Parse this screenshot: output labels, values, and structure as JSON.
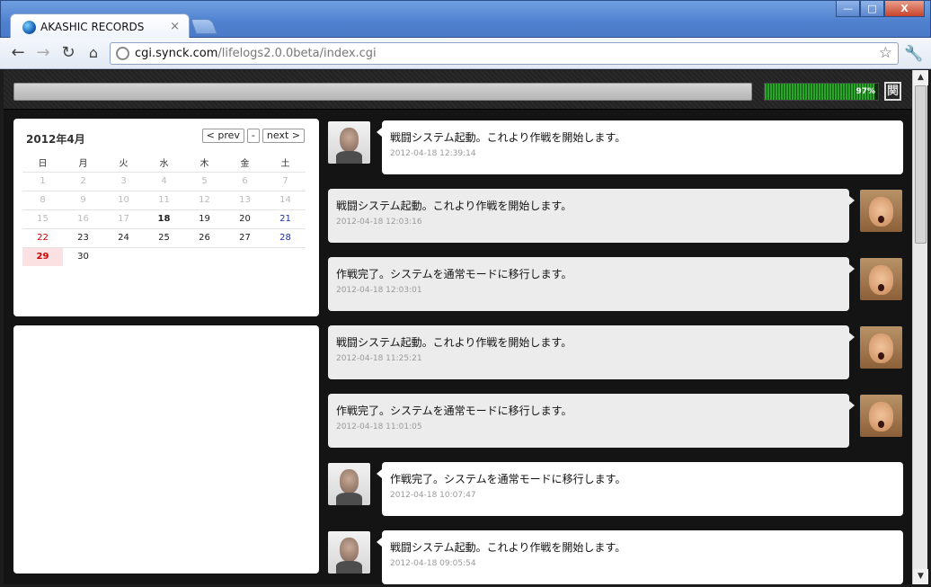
{
  "browser": {
    "tab_title": "AKASHIC RECORDS",
    "tab_close": "×",
    "url_host": "cgi.synck.com",
    "url_path": "/lifelogs2.0.0beta/index.cgi",
    "icons": [
      "globe-icon",
      "back-icon",
      "forward-icon",
      "reload-icon",
      "home-icon",
      "star-icon",
      "wrench-icon"
    ]
  },
  "header": {
    "meter_percent": 97,
    "meter_label": "97%",
    "logo_glyph": "関"
  },
  "calendar": {
    "title": "2012年4月",
    "prev_label": "< prev",
    "current_label": "-",
    "next_label": "next >",
    "weekdays": [
      "日",
      "月",
      "火",
      "水",
      "木",
      "金",
      "土"
    ],
    "weeks": [
      [
        "1",
        "2",
        "3",
        "4",
        "5",
        "6",
        "7"
      ],
      [
        "8",
        "9",
        "10",
        "11",
        "12",
        "13",
        "14"
      ],
      [
        "15",
        "16",
        "17",
        "18",
        "19",
        "20",
        "21"
      ],
      [
        "22",
        "23",
        "24",
        "25",
        "26",
        "27",
        "28"
      ],
      [
        "29",
        "30",
        "",
        "",
        "",
        "",
        ""
      ]
    ],
    "today": "29",
    "bold_day": "18"
  },
  "feed": [
    {
      "side": "left",
      "avatar": "man",
      "message": "戦闘システム起動。これより作戦を開始します。",
      "time": "2012-04-18 12:39:14"
    },
    {
      "side": "right",
      "avatar": "shout",
      "message": "戦闘システム起動。これより作戦を開始します。",
      "time": "2012-04-18 12:03:16"
    },
    {
      "side": "right",
      "avatar": "shout",
      "message": "作戦完了。システムを通常モードに移行します。",
      "time": "2012-04-18 12:03:01"
    },
    {
      "side": "right",
      "avatar": "shout",
      "message": "戦闘システム起動。これより作戦を開始します。",
      "time": "2012-04-18 11:25:21"
    },
    {
      "side": "right",
      "avatar": "shout",
      "message": "作戦完了。システムを通常モードに移行します。",
      "time": "2012-04-18 11:01:05"
    },
    {
      "side": "left",
      "avatar": "man",
      "message": "作戦完了。システムを通常モードに移行します。",
      "time": "2012-04-18 10:07:47"
    },
    {
      "side": "left",
      "avatar": "man",
      "message": "戦闘システム起動。これより作戦を開始します。",
      "time": "2012-04-18 09:05:54"
    }
  ],
  "scrollbar": {
    "up": "▲",
    "down": "▼"
  },
  "window": {
    "minimize": "—",
    "maximize": "□",
    "close": "X"
  }
}
